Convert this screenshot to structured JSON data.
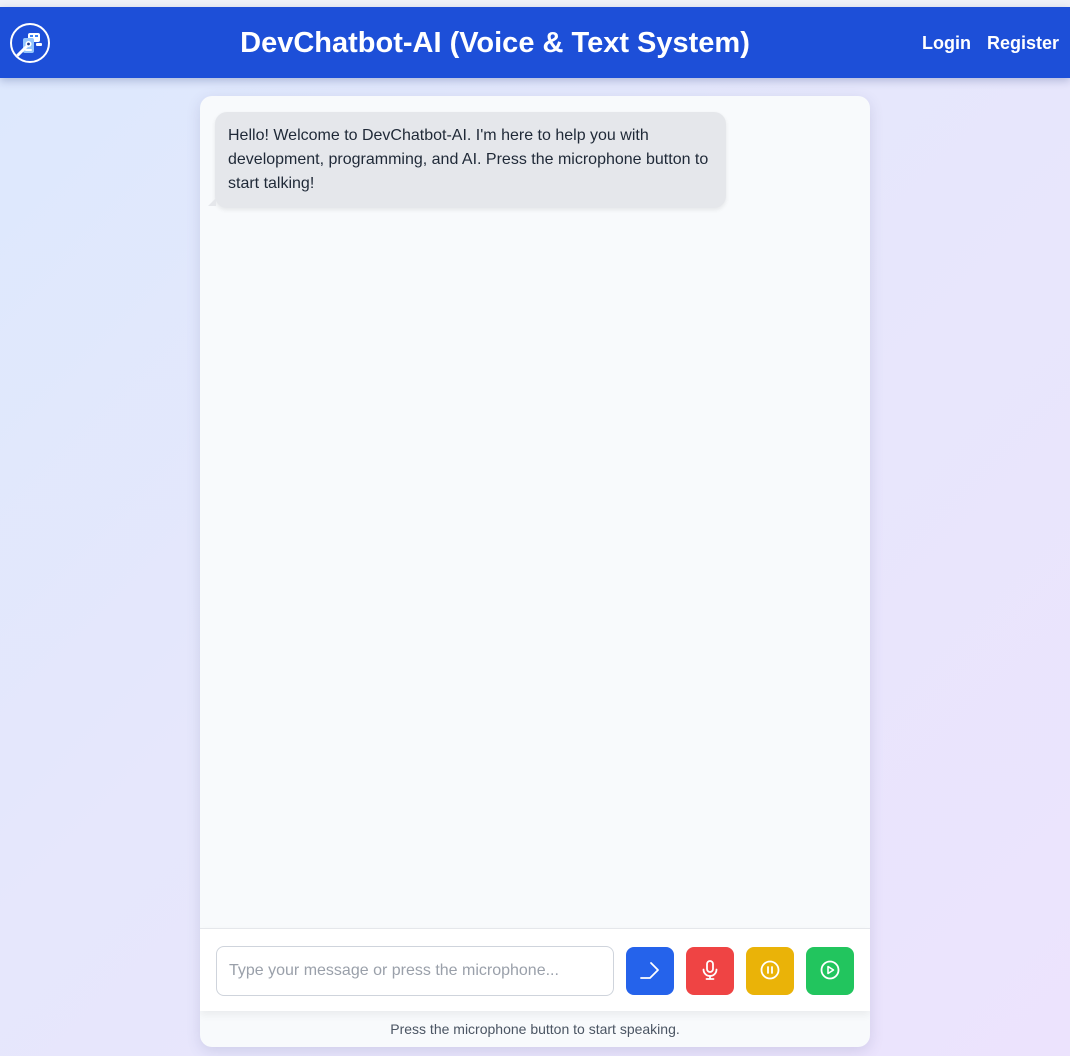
{
  "header": {
    "title": "DevChatbot-AI (Voice & Text System)",
    "logo_icon": "robot-chat-icon",
    "nav": {
      "login_label": "Login",
      "register_label": "Register"
    },
    "background_color": "#1d4fd8"
  },
  "chat": {
    "messages": [
      {
        "sender": "bot",
        "text": "Hello! Welcome to DevChatbot-AI. I'm here to help you with development, programming, and AI. Press the microphone button to start talking!"
      }
    ]
  },
  "composer": {
    "input_placeholder": "Type your message or press the microphone...",
    "input_value": "",
    "buttons": [
      {
        "name": "send",
        "icon": "send-arrow-icon",
        "color": "#2563eb"
      },
      {
        "name": "microphone",
        "icon": "microphone-icon",
        "color": "#ef4444"
      },
      {
        "name": "pause",
        "icon": "pause-circle-icon",
        "color": "#eab308"
      },
      {
        "name": "play",
        "icon": "play-circle-icon",
        "color": "#22c55e"
      }
    ]
  },
  "status": {
    "text": "Press the microphone button to start speaking."
  }
}
